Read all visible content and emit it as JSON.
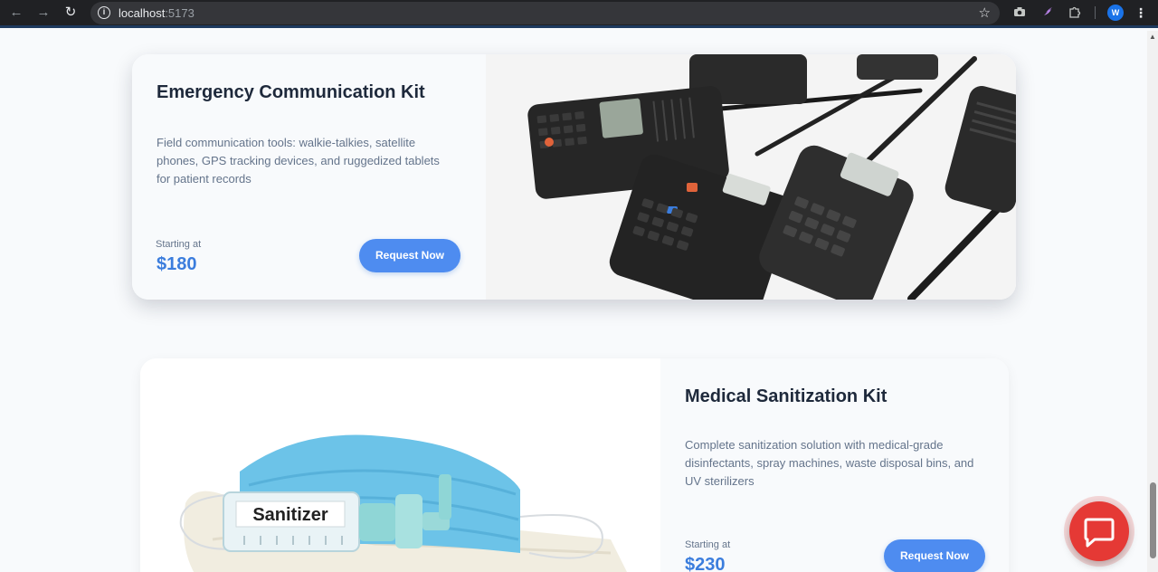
{
  "browser": {
    "url_host": "localhost",
    "url_port": ":5173",
    "profile_initial": "W"
  },
  "products": [
    {
      "title": "Emergency Communication Kit",
      "description": "Field communication tools: walkie-talkies, satellite phones, GPS tracking devices, and ruggedized tablets for patient records",
      "starting_label": "Starting at",
      "price": "$180",
      "button_label": "Request Now"
    },
    {
      "title": "Medical Sanitization Kit",
      "description": "Complete sanitization solution with medical-grade disinfectants, spray machines, waste disposal bins, and UV sterilizers",
      "starting_label": "Starting at",
      "price": "$230",
      "button_label": "Request Now",
      "image_label": "Sanitizer"
    }
  ],
  "icons": {
    "back": "arrow-left-icon",
    "forward": "arrow-right-icon",
    "reload": "reload-icon",
    "info": "info-icon",
    "bookmark": "star-icon",
    "chat": "chat-bubble-icon"
  },
  "colors": {
    "accent": "#4e8cf0",
    "price": "#3b7ddd",
    "chat": "#e53935"
  }
}
